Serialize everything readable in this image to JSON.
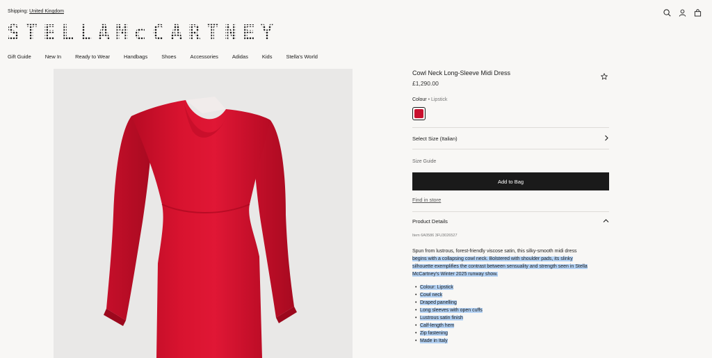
{
  "header": {
    "shipping_label": "Shipping:",
    "shipping_country": "United Kingdom",
    "logo_text": "STELLAMcCARTNEY"
  },
  "icons": [
    "search-icon",
    "account-icon",
    "bag-icon"
  ],
  "nav": {
    "items": [
      "Gift Guide",
      "New In",
      "Ready to Wear",
      "Handbags",
      "Shoes",
      "Accessories",
      "Adidas",
      "Kids",
      "Stella's World"
    ]
  },
  "product": {
    "title": "Cowl Neck Long-Sleeve Midi Dress",
    "price": "£1,290.00",
    "colour_label": "Colour",
    "colour_value": "Lipstick",
    "colour_hex": "#c8102e",
    "select_size": "Select Size (Italian)",
    "size_guide": "Size Guide",
    "add_to_bag": "Add to Bag",
    "find_in_store": "Find in store",
    "details_heading": "Product Details",
    "item_code": "Item 6A0586 3FU3026527",
    "description_plain": "Spun from lustrous, forest-friendly viscose satin, this silky-smooth midi dress",
    "description_highlight": "begins with a collapsing cowl neck. Bolstered with shoulder pads, its slinky silhouette exemplifies the contrast between sensuality and strength seen in Stella McCartney's Winter 2025 runway show.",
    "features": [
      "Colour: Lipstick",
      "Cowl neck",
      "Draped panelling",
      "Long sleeves with open cuffs",
      "Lustrous satin finish",
      "Calf-length hem",
      "Zip fastening",
      "Made in Italy"
    ]
  }
}
